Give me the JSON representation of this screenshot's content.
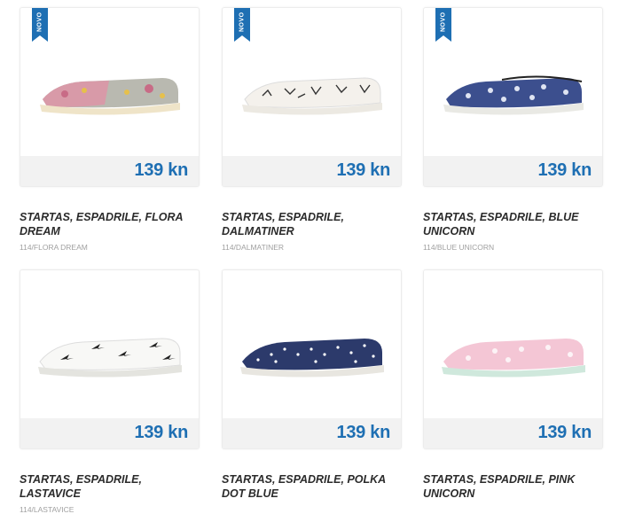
{
  "badge_label": "NOVO",
  "accent_color": "#1e6fb3",
  "products": [
    {
      "name": "STARTAS, ESPADRILE, FLORA DREAM",
      "sku": "114/FLORA DREAM",
      "price": "139 kn",
      "is_new": true
    },
    {
      "name": "STARTAS, ESPADRILE, DALMATINER",
      "sku": "114/DALMATINER",
      "price": "139 kn",
      "is_new": true
    },
    {
      "name": "STARTAS, ESPADRILE, BLUE UNICORN",
      "sku": "114/BLUE UNICORN",
      "price": "139 kn",
      "is_new": true
    },
    {
      "name": "STARTAS, ESPADRILE, LASTAVICE",
      "sku": "114/LASTAVICE",
      "price": "139 kn",
      "is_new": false
    },
    {
      "name": "STARTAS, ESPADRILE, POLKA DOT BLUE",
      "sku": "",
      "price": "139 kn",
      "is_new": false
    },
    {
      "name": "STARTAS, ESPADRILE, PINK UNICORN",
      "sku": "",
      "price": "139 kn",
      "is_new": false
    }
  ]
}
